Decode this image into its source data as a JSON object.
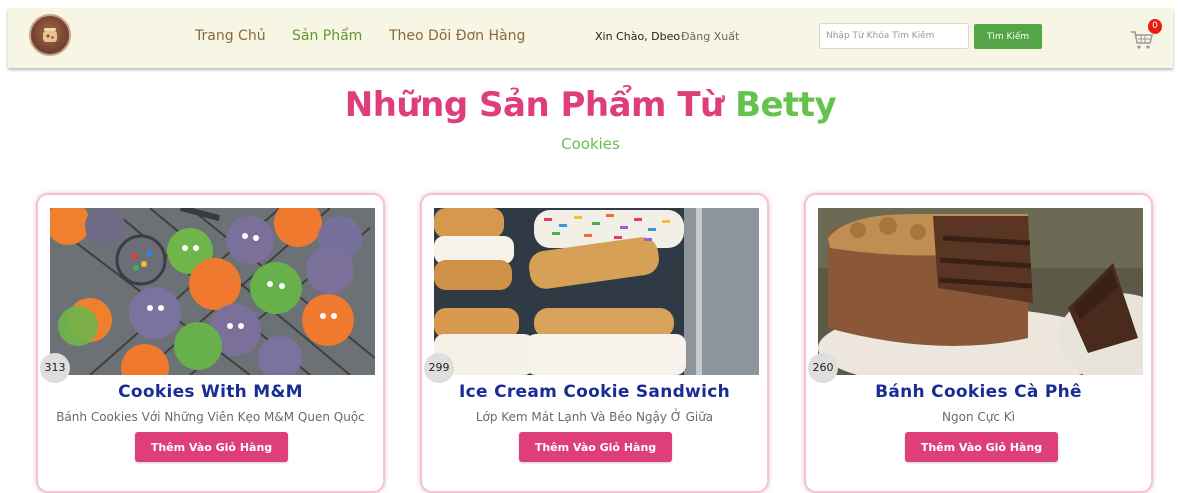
{
  "header": {
    "nav": {
      "home": "Trang Chủ",
      "products": "Sản Phẩm",
      "track_orders": "Theo Dõi Đơn Hàng"
    },
    "greeting": "Xin Chào, Dbeo",
    "logout": "Đăng Xuất",
    "search": {
      "placeholder": "Nhập Từ Khóa Tìm Kiếm",
      "value": "",
      "button": "Tìm Kiếm"
    },
    "cart_count": "0"
  },
  "page": {
    "title_main": "Những Sản Phẩm Từ",
    "title_accent": "Betty",
    "category": "Cookies"
  },
  "products": [
    {
      "views": "313",
      "name": "Cookies With M&M",
      "description": "Bánh Cookies Với Những Viên Kẹo M&M Quen Quộc",
      "button": "Thêm Vào Giỏ Hàng"
    },
    {
      "views": "299",
      "name": "Ice Cream Cookie Sandwich",
      "description": "Lớp Kem Mát Lạnh Và Béo Ngậy Ở Giữa",
      "button": "Thêm Vào Giỏ Hàng"
    },
    {
      "views": "260",
      "name": "Bánh Cookies Cà Phê",
      "description": "Ngon Cực Kì",
      "button": "Thêm Vào Giỏ Hàng"
    }
  ],
  "colors": {
    "header_bg": "#f7f5e3",
    "brand_pink": "#de3e7a",
    "brand_green": "#64c24d",
    "search_button": "#53a545",
    "product_name": "#1a2c95",
    "cart_badge": "#e81d0d"
  }
}
